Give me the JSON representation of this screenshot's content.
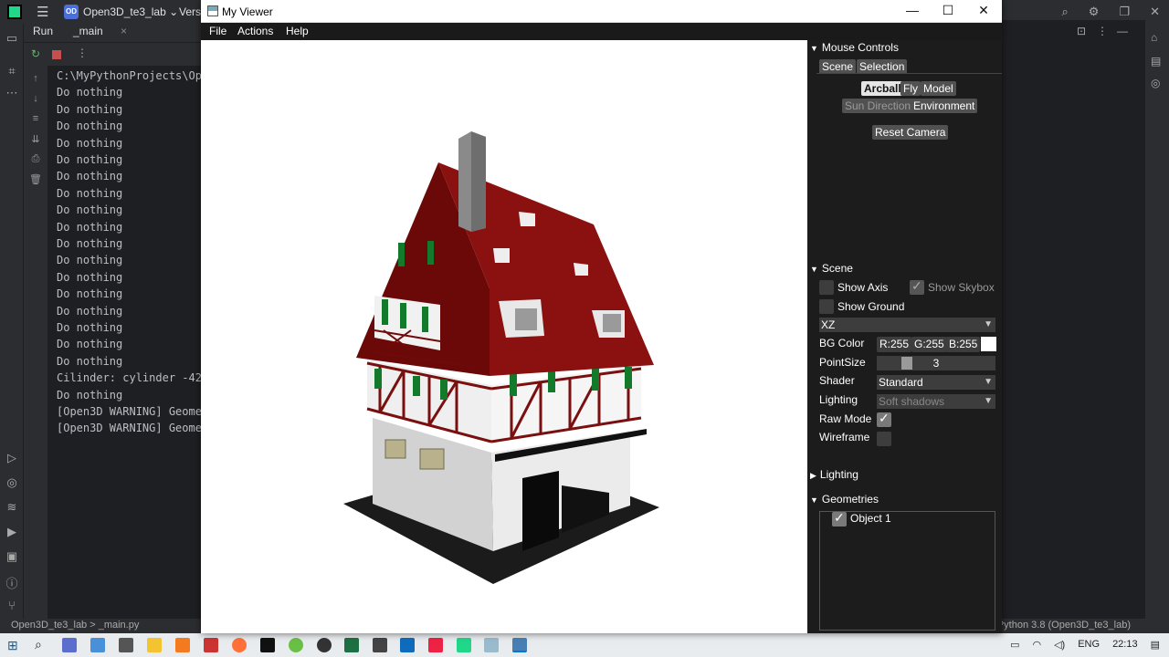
{
  "ide": {
    "project_badge": "OD",
    "project": "Open3D_te3_lab",
    "project_caret": "⌄",
    "vers_label": "Vers",
    "run_tab": "Run",
    "main_tab": "_main",
    "close_x": "×",
    "console_lines": [
      "C:\\MyPythonProjects\\Open",
      "Do nothing",
      "Do nothing",
      "Do nothing",
      "Do nothing",
      "Do nothing",
      "Do nothing",
      "Do nothing",
      "Do nothing",
      "Do nothing",
      "Do nothing",
      "Do nothing",
      "Do nothing",
      "Do nothing",
      "Do nothing",
      "Do nothing",
      "Do nothing",
      "Do nothing",
      "Cilinder: cylinder -42.5",
      "Do nothing",
      "[Open3D WARNING] Geometr",
      "[Open3D WARNING] Geometr"
    ],
    "status_left": "Open3D_te3_lab  >  _main.py",
    "status_right": "Python 3.8 (Open3D_te3_lab)"
  },
  "viewer": {
    "title": "My Viewer",
    "menu": [
      "File",
      "Actions",
      "Help"
    ],
    "controls": {
      "minimize": "—",
      "maximize": "☐",
      "close": "✕"
    }
  },
  "panel": {
    "mouse_controls": {
      "header": "Mouse Controls",
      "tabs": [
        "Scene",
        "Selection"
      ],
      "modes": [
        "Arcball",
        "Fly",
        "Model"
      ],
      "sun_direction": "Sun Direction",
      "environment": "Environment",
      "reset_camera": "Reset Camera"
    },
    "scene": {
      "header": "Scene",
      "show_axis": "Show Axis",
      "show_skybox": "Show Skybox",
      "show_ground": "Show Ground",
      "plane": "XZ",
      "bg_color_label": "BG Color",
      "bg_r": "R:255",
      "bg_g": "G:255",
      "bg_b": "B:255",
      "point_size_label": "PointSize",
      "point_size": "3",
      "shader_label": "Shader",
      "shader": "Standard",
      "lighting_label": "Lighting",
      "lighting_value": "Soft shadows",
      "raw_mode_label": "Raw Mode",
      "wireframe_label": "Wireframe",
      "raw_mode": true,
      "wireframe": false
    },
    "lighting_header": "Lighting",
    "geometries": {
      "header": "Geometries",
      "items": [
        "Object 1"
      ]
    }
  },
  "taskbar": {
    "language": "ENG",
    "time": "22:13"
  }
}
